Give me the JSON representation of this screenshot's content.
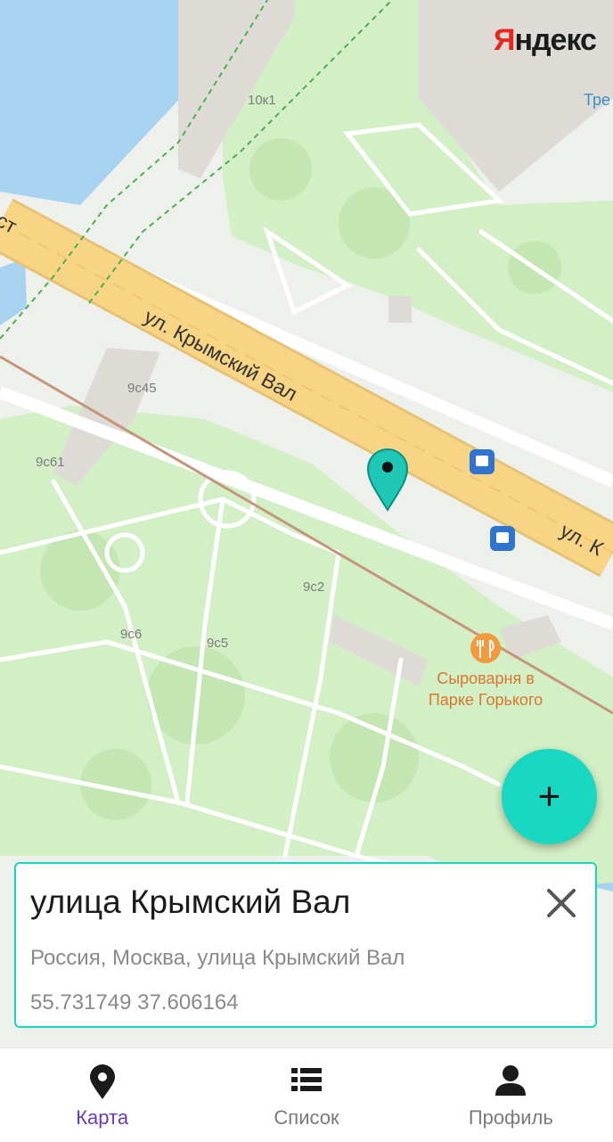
{
  "map": {
    "provider_logo": "Яндекс",
    "provider_logo_first": "Я",
    "provider_logo_rest": "ндекс",
    "street_labels": [
      "ул. Крымский Вал",
      "ул. К",
      "ст"
    ],
    "building_labels": [
      "10к1",
      "9с45",
      "9с61",
      "9с2",
      "9с6",
      "9с5",
      "Тре"
    ],
    "poi": {
      "name_line1": "Сыроварня в",
      "name_line2": "Парке Горького",
      "icon": "restaurant-icon"
    },
    "marker_icon": "location-pin-icon",
    "colors": {
      "water": "#a8d3f0",
      "park": "#cfeec2",
      "road_main": "#f7d17e",
      "accent": "#1ad4c0",
      "poi": "#f39a3d",
      "transit": "#2f74d0"
    }
  },
  "fab": {
    "label": "+",
    "icon": "plus-icon"
  },
  "place_card": {
    "title": "улица Крымский Вал",
    "address": "Россия, Москва, улица Крымский Вал",
    "coordinates": "55.731749 37.606164",
    "close_icon": "close-icon"
  },
  "bottom_nav": {
    "items": [
      {
        "label": "Карта",
        "icon": "location-pin-icon",
        "active": true
      },
      {
        "label": "Список",
        "icon": "list-icon",
        "active": false
      },
      {
        "label": "Профиль",
        "icon": "person-icon",
        "active": false
      }
    ],
    "active_color": "#6b3ab8"
  }
}
